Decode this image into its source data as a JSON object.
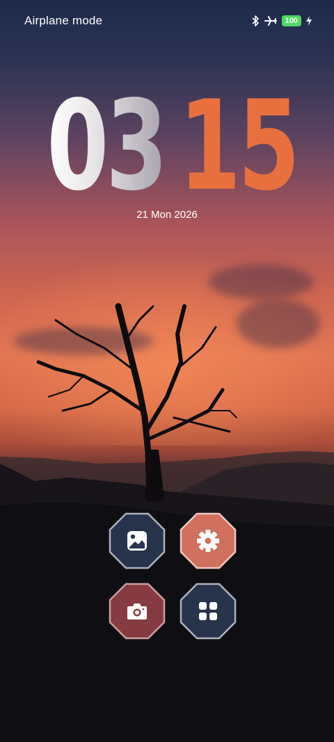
{
  "status_bar": {
    "title": "Airplane mode",
    "battery_level": "100",
    "icons": [
      "bluetooth-icon",
      "airplane-icon",
      "battery-icon",
      "charging-bolt-icon"
    ]
  },
  "clock": {
    "hours": "03",
    "minutes": "15"
  },
  "date": "21 Mon 2026",
  "shortcuts": [
    {
      "name": "gallery",
      "icon": "image-icon",
      "color": "#2a3550"
    },
    {
      "name": "settings",
      "icon": "gear-icon",
      "color": "#d0705f"
    },
    {
      "name": "camera",
      "icon": "camera-icon",
      "color": "#8c3e44"
    },
    {
      "name": "apps",
      "icon": "grid-icon",
      "color": "#2a3550"
    }
  ],
  "colors": {
    "accent": "#e8703e",
    "battery": "#4cd964"
  }
}
